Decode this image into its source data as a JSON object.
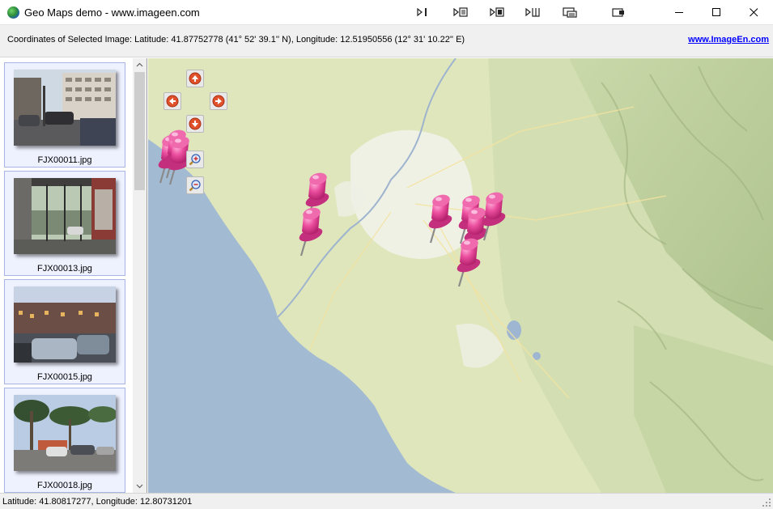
{
  "window": {
    "title": "Geo Maps demo - www.imageen.com",
    "toolbar_icons": [
      "first-page-icon",
      "previous-page-icon",
      "next-page-icon",
      "last-page-icon",
      "screen-view-icon",
      "export-icon"
    ]
  },
  "infobar": {
    "coordinates": "Coordinates of Selected Image:  Latitude: 41.87752778 (41° 52' 39.1'' N), Longitude: 12.51950556 (12° 31' 10.22'' E)",
    "link": "www.ImageEn.com"
  },
  "thumbnails": [
    {
      "filename": "FJX00011.jpg"
    },
    {
      "filename": "FJX00013.jpg"
    },
    {
      "filename": "FJX00015.jpg"
    },
    {
      "filename": "FJX00018.jpg"
    }
  ],
  "map": {
    "nav_buttons": [
      "arrow-up-icon",
      "arrow-left-icon",
      "arrow-right-icon",
      "arrow-down-icon",
      "zoom-in-icon",
      "zoom-out-icon"
    ],
    "pin_count": 10,
    "colors": {
      "sea": "#a3bad3",
      "land": "#dfe6bb",
      "pin": "#e8479a"
    }
  },
  "status": {
    "text": "Latitude: 41.80817277, Longitude: 12.80731201"
  }
}
